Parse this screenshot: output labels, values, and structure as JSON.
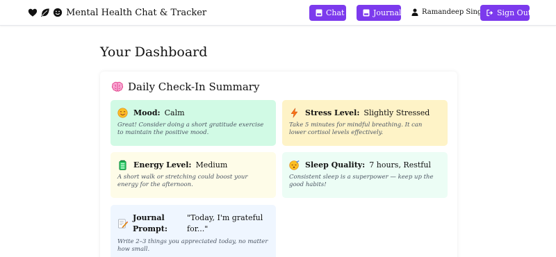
{
  "app": {
    "title": "Mental Health Chat & Tracker",
    "brand_icons": [
      "heart-icon",
      "leaf-icon",
      "smile-icon"
    ]
  },
  "nav": {
    "chat_label": "Chat",
    "journal_label": "Journal",
    "user_name": "Ramandeep Singh",
    "signout_label": "Sign Out",
    "accent_color": "#7c3aed"
  },
  "dashboard": {
    "title": "Your Dashboard",
    "summary_title": "Daily Check-In Summary",
    "summary_icon": "brain-icon",
    "cards": {
      "mood": {
        "icon": "smiling-face-icon",
        "label": "Mood:",
        "value": "Calm",
        "tip": "Great! Consider doing a short gratitude exercise to maintain the positive mood.",
        "color": "#d1fae5"
      },
      "stress": {
        "icon": "lightning-icon",
        "label": "Stress Level:",
        "value": "Slightly Stressed",
        "tip": "Take 5 minutes for mindful breathing. It can lower cortisol levels effectively.",
        "color": "#fef3c7"
      },
      "energy": {
        "icon": "battery-icon",
        "label": "Energy Level:",
        "value": "Medium",
        "tip": "A short walk or stretching could boost your energy for the afternoon.",
        "color": "#fefce8"
      },
      "sleep": {
        "icon": "sleeping-face-icon",
        "label": "Sleep Quality:",
        "value": "7 hours, Restful",
        "tip": "Consistent sleep is a superpower — keep up the good habits!",
        "color": "#ecfdf5"
      },
      "journal": {
        "icon": "memo-icon",
        "label": "Journal Prompt:",
        "value": "\"Today, I'm grateful for...\"",
        "tip": "Write 2–3 things you appreciated today, no matter how small.",
        "color": "#eff6ff"
      }
    }
  }
}
